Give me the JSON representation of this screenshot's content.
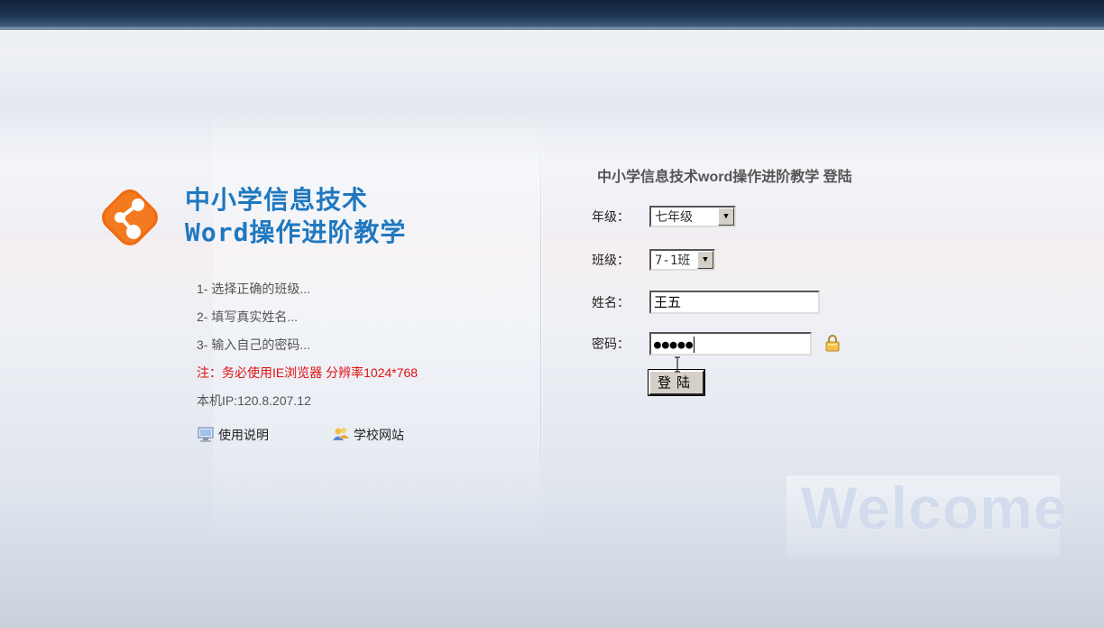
{
  "brand": {
    "title_line1": "中小学信息技术",
    "title_line2": "Word操作进阶教学",
    "logo_icon": "share-nodes-icon",
    "accent_color": "#1f78c0",
    "logo_color": "#f06a10"
  },
  "steps": [
    "1- 选择正确的班级...",
    "2- 填写真实姓名...",
    "3- 输入自己的密码..."
  ],
  "notice": "注：务必使用IE浏览器 分辨率1024*768",
  "ip_label": "本机IP:120.8.207.12",
  "links": {
    "manual": {
      "label": "使用说明",
      "icon": "monitor-icon"
    },
    "school_site": {
      "label": "学校网站",
      "icon": "users-icon"
    }
  },
  "login": {
    "title": "中小学信息技术word操作进阶教学 登陆",
    "grade_label": "年级：",
    "grade_value": "七年级",
    "class_label": "班级：",
    "class_value": "7-1班",
    "name_label": "姓名：",
    "name_value": "王五",
    "password_label": "密码：",
    "password_value": "●●●●●",
    "submit_label": "登陆",
    "lock_icon": "padlock-icon"
  },
  "watermark": "Welcome"
}
